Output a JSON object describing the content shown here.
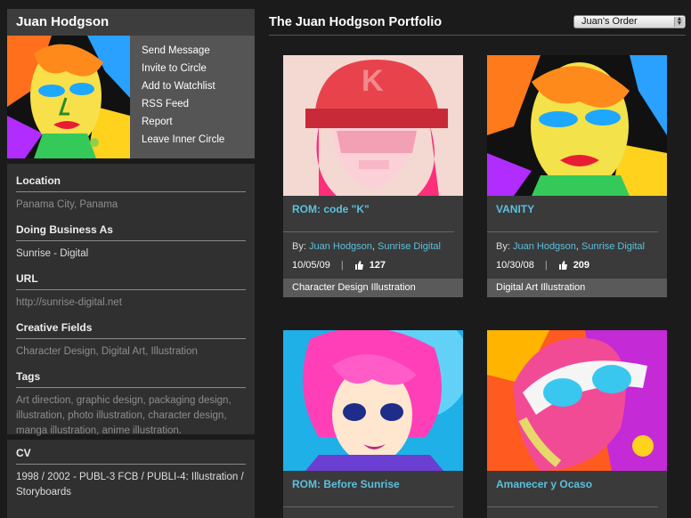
{
  "profile": {
    "name": "Juan Hodgson",
    "actions": [
      "Send Message",
      "Invite to Circle",
      "Add to Watchlist",
      "RSS Feed",
      "Report",
      "Leave Inner Circle"
    ]
  },
  "info": {
    "location_label": "Location",
    "location": "Panama City, Panama",
    "dba_label": "Doing Business As",
    "dba": "Sunrise - Digital",
    "url_label": "URL",
    "url": "http://sunrise-digital.net",
    "fields_label": "Creative Fields",
    "fields": "Character Design, Digital Art, Illustration",
    "tags_label": "Tags",
    "tags": "Art direction, graphic design, packaging design, illustration, photo illustration, character design, manga illustration, anime illustration."
  },
  "cv": {
    "label": "CV",
    "text": "1998 / 2002 - PUBL-3 FCB / PUBLI-4: Illustration / Storyboards"
  },
  "main": {
    "title": "The Juan Hodgson Portfolio",
    "order_value": "Juan's Order"
  },
  "cards": [
    {
      "title": "ROM: code \"K\"",
      "by_label": "By:",
      "author": "Juan Hodgson",
      "company": "Sunrise Digital",
      "date": "10/05/09",
      "sep": "|",
      "count": "127",
      "tags": "Character Design  Illustration"
    },
    {
      "title": "VANITY",
      "by_label": "By:",
      "author": "Juan Hodgson",
      "company": "Sunrise Digital",
      "date": "10/30/08",
      "sep": "|",
      "count": "209",
      "tags": "Digital Art  Illustration"
    },
    {
      "title": "ROM: Before Sunrise"
    },
    {
      "title": "Amanecer y Ocaso"
    }
  ],
  "colors": {
    "accent": "#5bc0de",
    "background": "#1b1b1b",
    "panel": "#303030"
  }
}
